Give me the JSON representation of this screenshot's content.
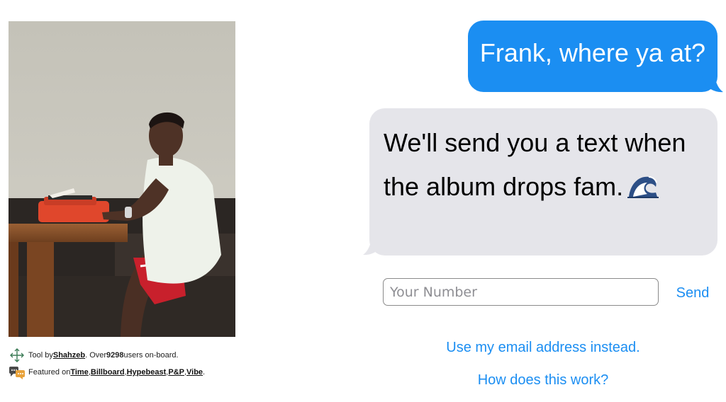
{
  "photo": {
    "alt": "Man typing on a red typewriter"
  },
  "credits": {
    "tool_prefix": "Tool by ",
    "author": "Shahzeb",
    "users_prefix": ". Over ",
    "user_count": "9298",
    "users_suffix": " users on-board.",
    "featured_prefix": "Featured on ",
    "outlets": [
      "Time",
      "Billboard",
      "Hypebeast",
      "P&P",
      "Vibe"
    ],
    "separator": ", ",
    "end": "."
  },
  "chat": {
    "outgoing": "Frank, where ya at?",
    "incoming": "We'll send you a text when the album drops fam.",
    "incoming_emoji": "wave-icon",
    "colors": {
      "outgoing_bg": "#1b8ef2",
      "incoming_bg": "#e5e5ea"
    }
  },
  "form": {
    "number_placeholder": "Your Number",
    "number_value": "",
    "send_label": "Send",
    "email_link": "Use my email address instead.",
    "help_link": "How does this work?"
  }
}
